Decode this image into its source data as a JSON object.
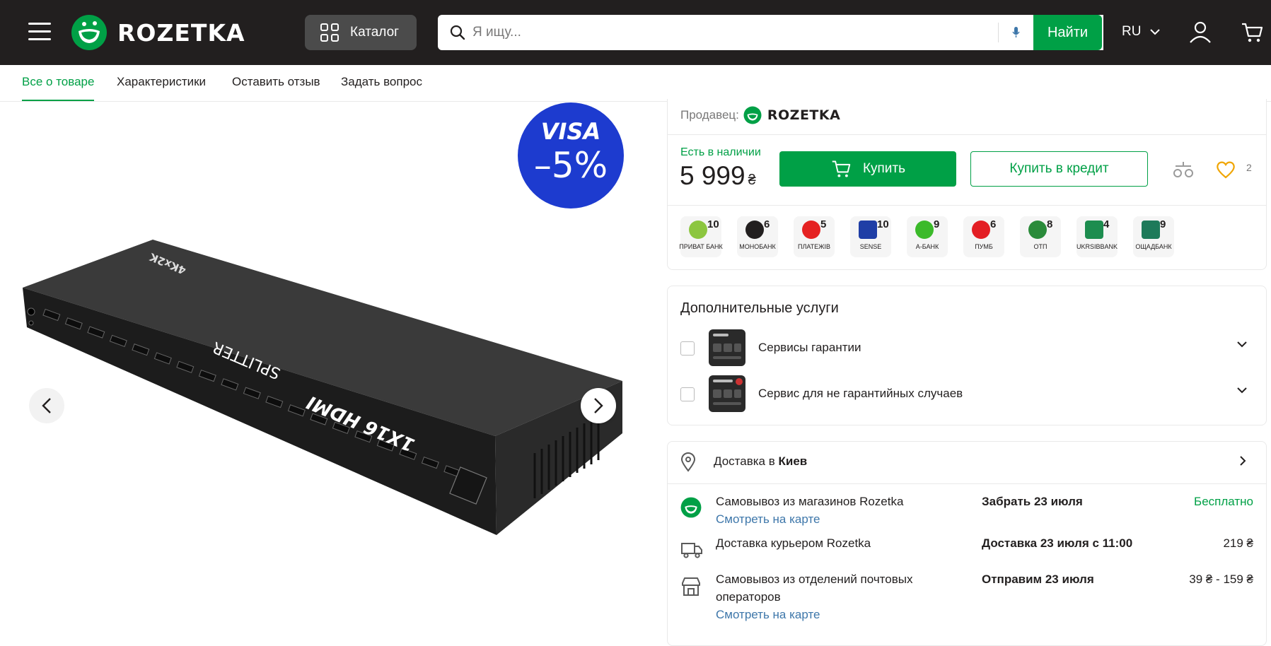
{
  "header": {
    "logo_text": "ROZETKA",
    "catalog_label": "Каталог",
    "search_placeholder": "Я ищу...",
    "find_label": "Найти",
    "language": "RU",
    "colors": {
      "bg": "#221f1f",
      "brand": "#00a046",
      "catalog_bg": "#4b4b4b"
    }
  },
  "tabs": [
    {
      "label": "Все о товаре",
      "active": true
    },
    {
      "label": "Характеристики"
    },
    {
      "label": "Оставить отзыв"
    },
    {
      "label": "Задать вопрос"
    }
  ],
  "gallery": {
    "promo_badge": {
      "brand": "VISA",
      "discount": "–5%",
      "color": "#1d3bcf"
    },
    "product_print": {
      "brand": "1X16 HDMI",
      "model": "SPLITTER",
      "badge": "4Kx2K"
    }
  },
  "purchase": {
    "seller_label": "Продавец:",
    "seller_name": "ROZETKA",
    "availability": "Есть в наличии",
    "price": "5 999",
    "currency": "₴",
    "buy_label": "Купить",
    "credit_label": "Купить в кредит",
    "favorites_count": "2"
  },
  "banks": [
    {
      "name": "ПРИВАТ БАНК",
      "num": "10",
      "icon": "privatbank-icon",
      "color": "#8cc63f"
    },
    {
      "name": "МОНОБАНК",
      "num": "6",
      "icon": "monobank-paw-icon",
      "color": "#221f1f"
    },
    {
      "name": "ПЛАТЕЖІВ",
      "num": "5",
      "icon": "zero-percent-icon",
      "color": "#e52222"
    },
    {
      "name": "SENSE",
      "num": "10",
      "icon": "sense-icon",
      "color": "#1f3ea6"
    },
    {
      "name": "А-БАНК",
      "num": "9",
      "icon": "abank-apple-icon",
      "color": "#3bba2a"
    },
    {
      "name": "ПУМБ",
      "num": "6",
      "icon": "pumb-icon",
      "color": "#e31e24"
    },
    {
      "name": "ОТП",
      "num": "8",
      "icon": "otp-icon",
      "color": "#2a8b3a"
    },
    {
      "name": "UKRSIBBANK",
      "num": "4",
      "icon": "ukrsibbank-icon",
      "color": "#1d8d4f"
    },
    {
      "name": "ОЩАДБАНК",
      "num": "9",
      "icon": "oschadbank-icon",
      "color": "#1e7a5a"
    }
  ],
  "services": {
    "title": "Дополнительные услуги",
    "items": [
      {
        "label": "Сервисы гарантии"
      },
      {
        "label": "Сервис для не гарантийных случаев"
      }
    ]
  },
  "delivery": {
    "prefix": "Доставка в",
    "city": "Киев",
    "options": [
      {
        "name": "Самовывоз из магазинов Rozetka",
        "map": "Смотреть на карте",
        "when": "Забрать 23 июля",
        "cost": "Бесплатно",
        "icon": "rozetka-smile-icon"
      },
      {
        "name": "Доставка курьером Rozetka",
        "map": "",
        "when": "Доставка 23 июля с 11:00",
        "cost": "219 ₴",
        "icon": "truck-icon"
      },
      {
        "name": "Самовывоз из отделений почтовых операторов",
        "map": "Смотреть на карте",
        "when": "Отправим 23 июля",
        "cost": "39 ₴ - 159 ₴",
        "icon": "store-icon"
      }
    ]
  }
}
